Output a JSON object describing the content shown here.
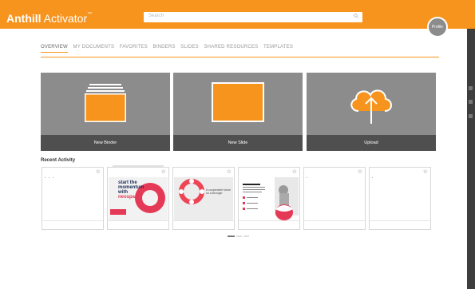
{
  "app": {
    "logo_bold": "Anthill",
    "logo_light": " Activator",
    "logo_tm": "™"
  },
  "search": {
    "placeholder": "Search"
  },
  "profile": {
    "label": "Profile"
  },
  "nav": {
    "tabs": [
      {
        "label": "OVERVIEW"
      },
      {
        "label": "MY DOCUMENTS"
      },
      {
        "label": "FAVORITES"
      },
      {
        "label": "BINDERS"
      },
      {
        "label": "SLIDES"
      },
      {
        "label": "SHARED RESOURCES"
      },
      {
        "label": "TEMPLATES"
      }
    ]
  },
  "tiles": [
    {
      "label": "New Binder",
      "icon": "binder-icon"
    },
    {
      "label": "New Slide",
      "icon": "slide-icon"
    },
    {
      "label": "Upload",
      "icon": "cloud-upload-icon"
    }
  ],
  "recent": {
    "title": "Recent Activity",
    "card2_text": [
      "start the",
      "momentum",
      "with",
      "neospan"
    ],
    "card3_text": "A cooperative future on a stronger"
  },
  "colors": {
    "accent": "#f7941d",
    "tile": "#8c8c8c",
    "tile_label": "#4f4f4f"
  }
}
